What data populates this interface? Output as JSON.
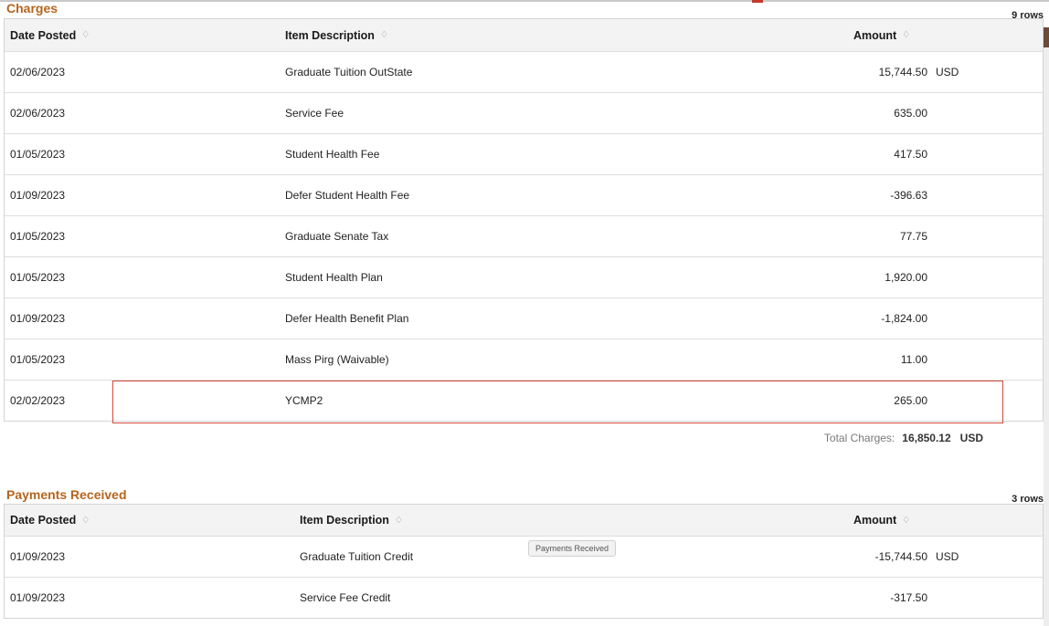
{
  "charges": {
    "title": "Charges",
    "row_count": "9 rows",
    "columns": {
      "date": "Date Posted",
      "desc": "Item Description",
      "amount": "Amount"
    },
    "sort_glyph": "♢",
    "rows": [
      {
        "date": "02/06/2023",
        "desc": "Graduate Tuition OutState",
        "amount": "15,744.50",
        "currency": "USD"
      },
      {
        "date": "02/06/2023",
        "desc": "Service Fee",
        "amount": "635.00",
        "currency": ""
      },
      {
        "date": "01/05/2023",
        "desc": "Student Health Fee",
        "amount": "417.50",
        "currency": ""
      },
      {
        "date": "01/09/2023",
        "desc": "Defer Student Health Fee",
        "amount": "-396.63",
        "currency": ""
      },
      {
        "date": "01/05/2023",
        "desc": "Graduate Senate Tax",
        "amount": "77.75",
        "currency": ""
      },
      {
        "date": "01/05/2023",
        "desc": "Student Health Plan",
        "amount": "1,920.00",
        "currency": ""
      },
      {
        "date": "01/09/2023",
        "desc": "Defer Health Benefit Plan",
        "amount": "-1,824.00",
        "currency": ""
      },
      {
        "date": "01/05/2023",
        "desc": "Mass Pirg (Waivable)",
        "amount": "11.00",
        "currency": ""
      },
      {
        "date": "02/02/2023",
        "desc": "YCMP2",
        "amount": "265.00",
        "currency": ""
      }
    ],
    "total_label": "Total Charges:",
    "total_value": "16,850.12",
    "total_currency": "USD"
  },
  "payments": {
    "title": "Payments Received",
    "row_count": "3 rows",
    "columns": {
      "date": "Date Posted",
      "desc": "Item Description",
      "amount": "Amount"
    },
    "sort_glyph": "♢",
    "rows": [
      {
        "date": "01/09/2023",
        "desc": "Graduate Tuition Credit",
        "amount": "-15,744.50",
        "currency": "USD"
      },
      {
        "date": "01/09/2023",
        "desc": "Service Fee Credit",
        "amount": "-317.50",
        "currency": ""
      }
    ]
  },
  "tooltip": "Payments Received",
  "colors": {
    "section_title": "#b5651d",
    "highlight_border": "#d24a3a",
    "header_bg": "#f3f3f3"
  }
}
